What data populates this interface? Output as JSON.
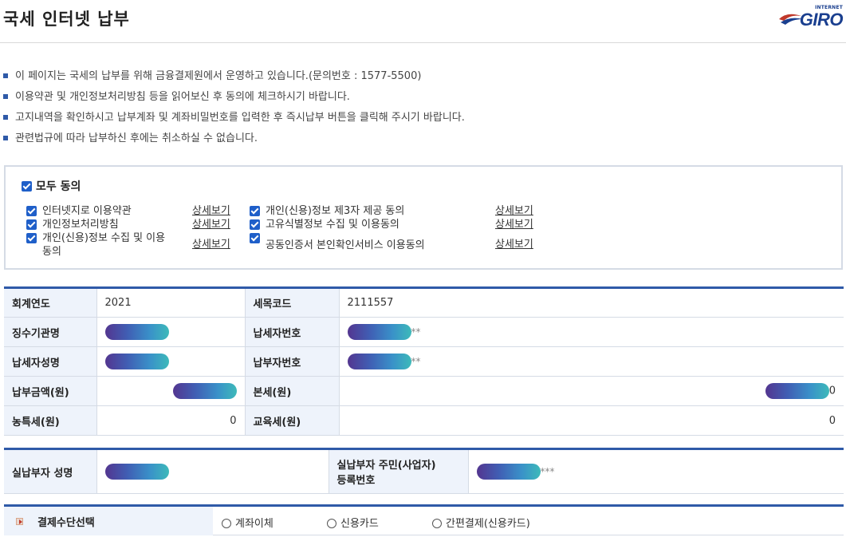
{
  "header": {
    "title": "국세 인터넷 납부",
    "logo_small": "INTERNET",
    "logo_main": "GIRO"
  },
  "notices": [
    "이 페이지는 국세의 납부를 위해 금융결제원에서 운영하고 있습니다.(문의번호 : 1577-5500)",
    "이용약관 및 개인정보처리방침 등을 읽어보신 후 동의에 체크하시기 바랍니다.",
    "고지내역을 확인하시고 납부계좌 및 계좌비밀번호를 입력한 후 즉시납부 버튼을 클릭해 주시기 바랍니다.",
    "관련법규에 따라 납부하신 후에는 취소하실 수 없습니다."
  ],
  "agreement": {
    "all_label": "모두 동의",
    "detail_label": "상세보기",
    "terms_left": [
      "인터넷지로 이용약관",
      "개인정보처리방침",
      "개인(신용)정보 수집 및 이용",
      "동의"
    ],
    "terms_right": [
      "개인(신용)정보 제3자 제공 동의",
      "고유식별정보 수집 및 이용동의",
      "공동인증서 본인확인서비스 이용동의"
    ]
  },
  "info_table": {
    "fiscal_year_label": "회계연도",
    "fiscal_year": "2021",
    "tax_code_label": "세목코드",
    "tax_code": "2111557",
    "agency_label": "징수기관명",
    "taxpayer_no_label": "납세자번호",
    "taxpayer_no_suffix": "**",
    "taxpayer_name_label": "납세자성명",
    "payment_no_label": "납부자번호",
    "payment_no_suffix": "**",
    "amount_label": "납부금액(원)",
    "base_tax_label": "본세(원)",
    "base_tax_suffix": "0",
    "rural_tax_label": "농특세(원)",
    "rural_tax": "0",
    "edu_tax_label": "교육세(원)",
    "edu_tax": "0"
  },
  "payer_table": {
    "name_label": "실납부자 성명",
    "id_label_1": "실납부자 주민(사업자)",
    "id_label_2": "등록번호",
    "id_suffix": "***"
  },
  "payment": {
    "label": "결제수단선택",
    "options": [
      "계좌이체",
      "신용카드",
      "간편결제(신용카드)"
    ]
  },
  "colors": {
    "accent": "#2f5aa8",
    "checkbox": "#1f5fc9",
    "header_cell": "#eef3fb"
  }
}
